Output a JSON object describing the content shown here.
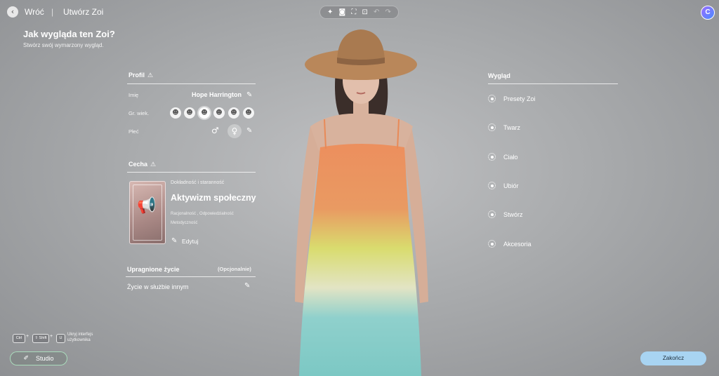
{
  "header": {
    "back_label": "Wróć",
    "separator": "|",
    "breadcrumb": "Utwórz Zoi",
    "toolbar_icons": [
      "sparkle-icon",
      "camera-icon",
      "frame-icon",
      "focus-icon",
      "undo-icon",
      "redo-icon"
    ],
    "avatar_letter": "C"
  },
  "page": {
    "title": "Jak wygląda ten Zoi?",
    "subtitle": "Stwórz swój wymarzony wygląd."
  },
  "profile": {
    "title": "Profil",
    "name_label": "Imię",
    "name_value": "Hope Harrington",
    "age_label": "Gr. wiek.",
    "gender_label": "Płeć"
  },
  "trait": {
    "title": "Cecha",
    "category": "Dokładność i staranność",
    "name": "Aktywizm społeczny",
    "tags_line1": "Racjonalność , Odpowiedzialność",
    "tags_line2": "Metodyczność",
    "edit_label": "Edytuj"
  },
  "aspiration": {
    "title": "Upragnione życie",
    "optional": "(Opcjonalnie)",
    "value": "Życie w służbie innym"
  },
  "appearance": {
    "title": "Wygląd",
    "items": [
      "Presety Zoi",
      "Twarz",
      "Ciało",
      "Ubiór",
      "Stwórz",
      "Akcesoria"
    ]
  },
  "shortcut": {
    "key1": "Ctrl",
    "key2": "⇧ Shift",
    "key3": "U",
    "plus": "+",
    "label_line1": "Ukryj interfejs",
    "label_line2": "użytkownika"
  },
  "buttons": {
    "studio": "Studio",
    "finish": "Zakończ"
  },
  "colors": {
    "finish_button": "#a8d4f2",
    "dress_top": "#ec8f5e",
    "dress_mid": "#d9dc6e",
    "dress_bottom": "#7cc8c4",
    "hat": "#b9875a"
  }
}
